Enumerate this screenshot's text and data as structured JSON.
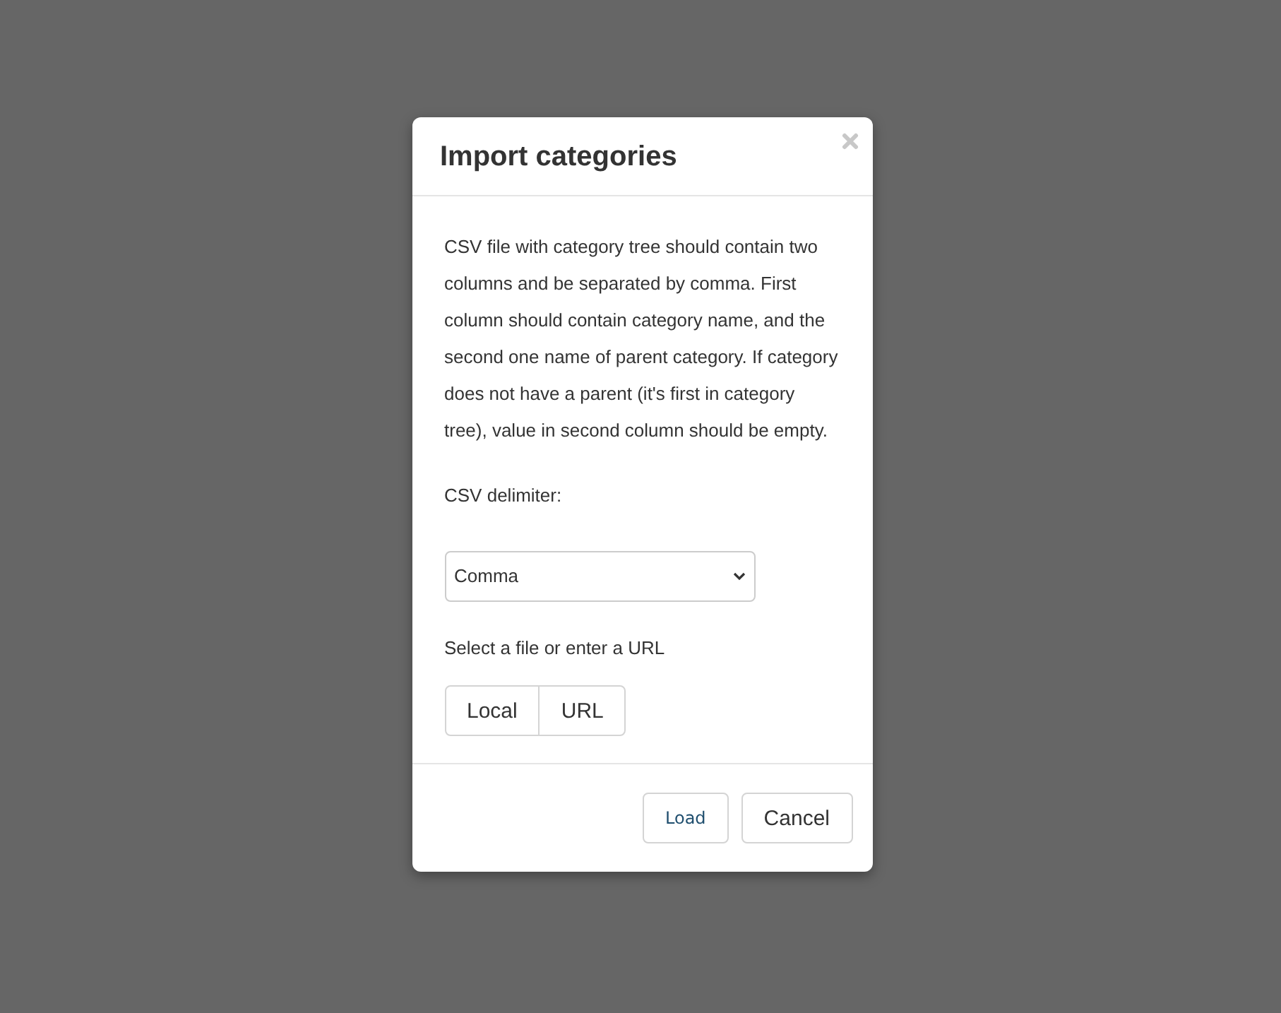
{
  "dialog": {
    "title": "Import categories",
    "description": "CSV file with category tree should contain two columns and be separated by comma. First column should contain category name, and the second one name of parent category. If category does not have a parent (it's first in category tree), value in second column should be empty.",
    "delimiter": {
      "label": "CSV delimiter:",
      "value": "Comma"
    },
    "source": {
      "label": "Select a file or enter a URL",
      "options": [
        "Local",
        "URL"
      ]
    },
    "buttons": [
      {
        "label": "Load",
        "kind": "link"
      },
      {
        "label": "Cancel",
        "kind": "default"
      }
    ]
  }
}
